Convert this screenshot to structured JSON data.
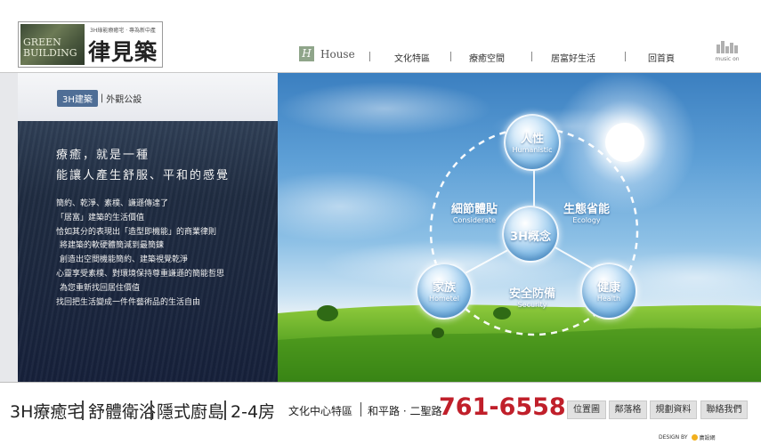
{
  "header": {
    "logo": {
      "mark_line1": "GREEN",
      "mark_line2": "BUILDING",
      "tagline": "3H綠能療癒宅 · 專為新中產",
      "name": "律見築"
    },
    "nav": {
      "home_badge": "H",
      "home_label": "House",
      "items": [
        "文化特區",
        "療癒空間",
        "居富好生活",
        "回首頁"
      ]
    },
    "music_label": "music on"
  },
  "left_panel": {
    "crumb_tag": "3H建築",
    "crumb_sep": "|",
    "crumb_text": "外觀公設",
    "headline": [
      "療癒，就是一種",
      "能讓人產生舒服、平和的感覺"
    ],
    "body": [
      "簡約、乾淨、素樸、謙遜傳達了",
      "「居富」建築的生活價值",
      "恰如其分的表現出「造型即機能」的商業律則",
      "將建築的軟硬體簡減到最簡鍊",
      "創造出空間機能簡約、建築視覺乾淨",
      "心靈享受素樸、對環境保持尊重謙遜的簡能哲思",
      "為您重新找回居住價值",
      "找回把生活變成一件件藝術品的生活自由"
    ]
  },
  "diagram": {
    "center": {
      "zh": "3H概念",
      "en": ""
    },
    "nodes": [
      {
        "zh": "人性",
        "en": "Humanistic"
      },
      {
        "zh": "家族",
        "en": "Hometel"
      },
      {
        "zh": "健康",
        "en": "Health"
      }
    ],
    "labels": [
      {
        "zh": "細節體貼",
        "en": "Considerate"
      },
      {
        "zh": "生態省能",
        "en": "Ecology"
      },
      {
        "zh": "安全防備",
        "en": "Security"
      }
    ]
  },
  "footer": {
    "features": [
      "3H療癒宅",
      "舒體衛浴",
      "隱式廚島",
      "2-4房"
    ],
    "location": "文化中心特區",
    "address": "和平路 · 二聖路",
    "phone": "761-6558",
    "buttons": [
      "位置圖",
      "鄰落格",
      "規劃資料",
      "聯絡我們"
    ],
    "credit_prefix": "DESIGN BY",
    "credit_name": "廣設網"
  }
}
